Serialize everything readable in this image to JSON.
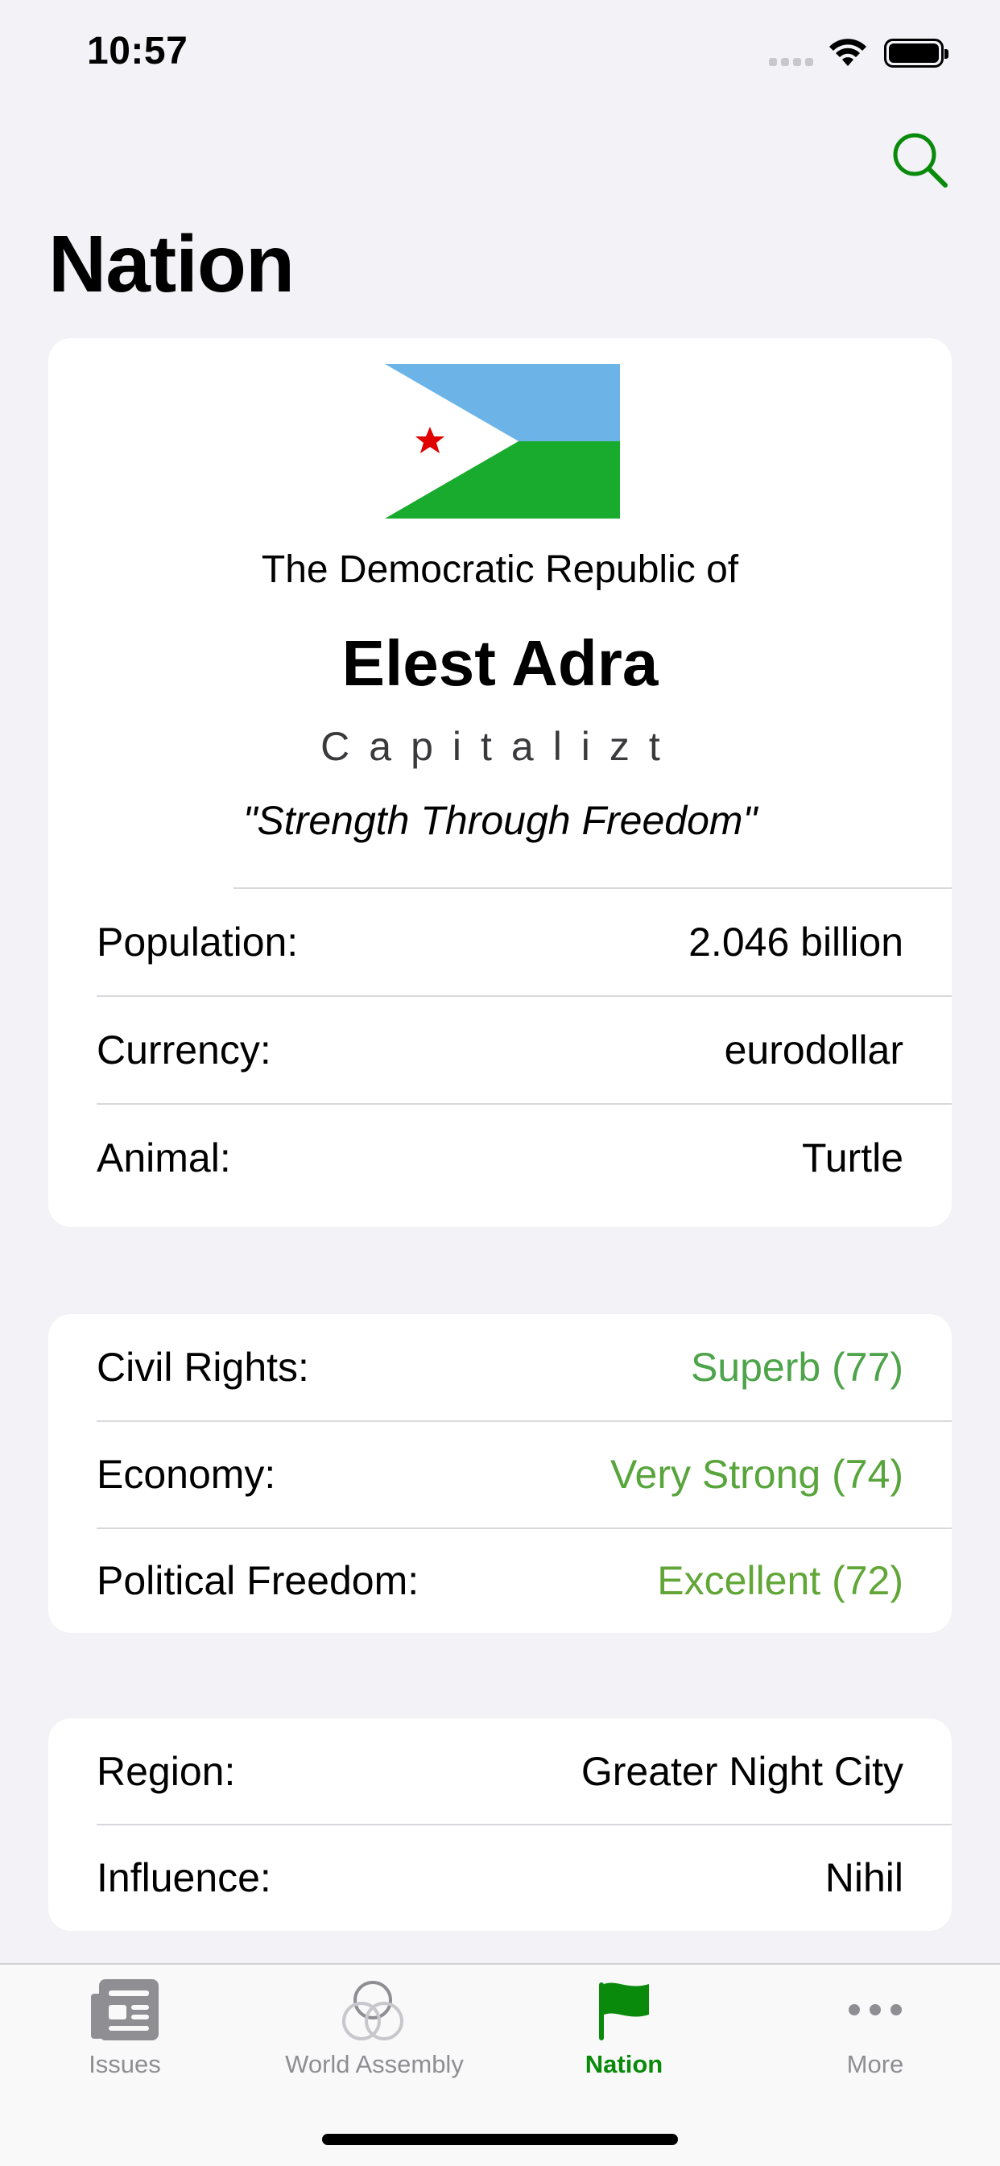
{
  "status_bar": {
    "time": "10:57"
  },
  "header": {
    "title": "Nation",
    "search_icon": "search-icon"
  },
  "nation": {
    "pretitle": "The Democratic Republic of",
    "name": "Elest Adra",
    "category": "Capitalizt",
    "motto": "\"Strength Through Freedom\"",
    "flag_colors": {
      "top": "#6cb4e8",
      "bottom": "#19ab2e",
      "triangle": "#ffffff",
      "star": "#e00000"
    }
  },
  "basic_info": [
    {
      "label": "Population:",
      "value": "2.046 billion"
    },
    {
      "label": "Currency:",
      "value": "eurodollar"
    },
    {
      "label": "Animal:",
      "value": "Turtle"
    }
  ],
  "freedoms": [
    {
      "label": "Civil Rights:",
      "value": "Superb (77)",
      "color": "#4ea44a"
    },
    {
      "label": "Economy:",
      "value": "Very Strong (74)",
      "color": "#58a53c"
    },
    {
      "label": "Political Freedom:",
      "value": "Excellent (72)",
      "color": "#61a636"
    }
  ],
  "region_info": [
    {
      "label": "Region:",
      "value": "Greater Night City"
    },
    {
      "label": "Influence:",
      "value": "Nihil"
    }
  ],
  "tabs": [
    {
      "label": "Issues",
      "icon": "newspaper-icon",
      "active": false
    },
    {
      "label": "World Assembly",
      "icon": "world-assembly-icon",
      "active": false
    },
    {
      "label": "Nation",
      "icon": "flag-icon",
      "active": true
    },
    {
      "label": "More",
      "icon": "more-icon",
      "active": false
    }
  ]
}
